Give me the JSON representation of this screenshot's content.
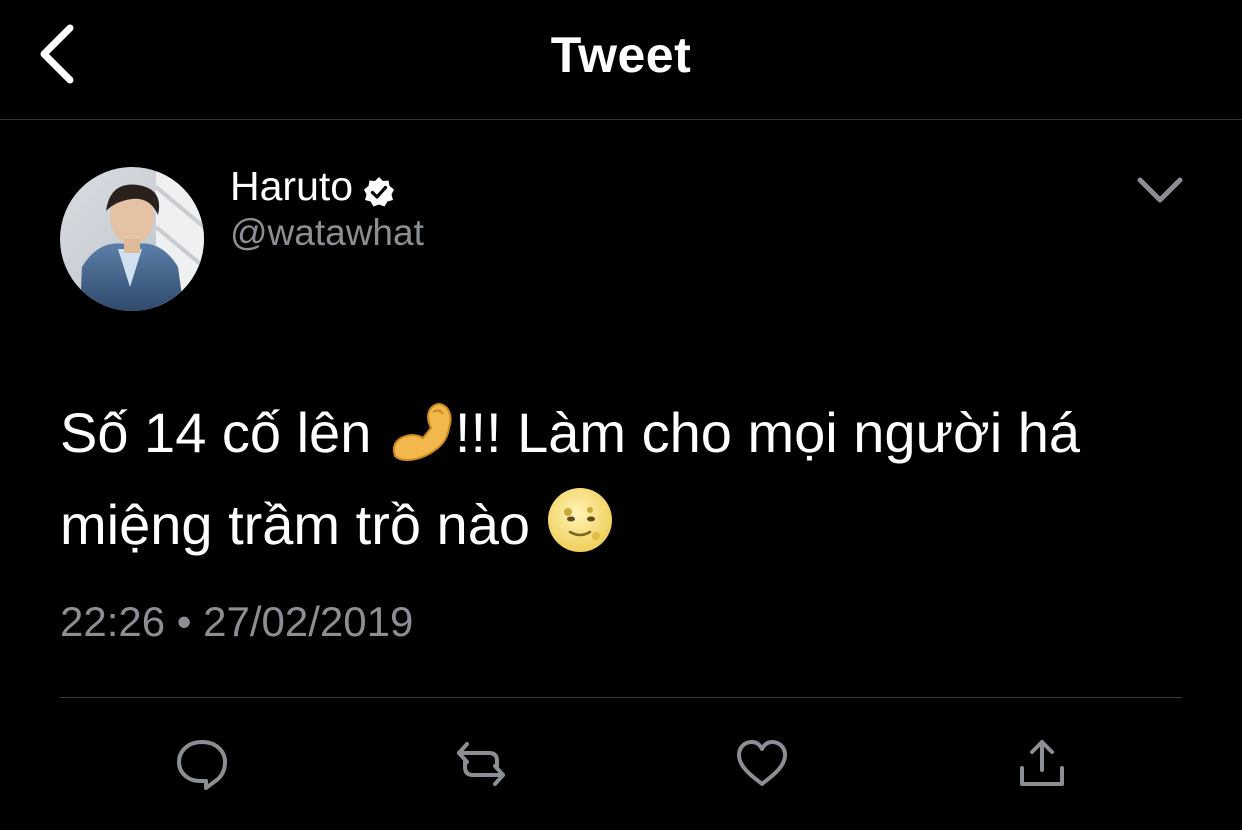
{
  "nav": {
    "title": "Tweet",
    "back_icon": "chevron-left-icon"
  },
  "tweet": {
    "author": {
      "display_name": "Haruto",
      "handle": "@watawhat",
      "verified_icon": "verified-badge-icon"
    },
    "text_line1_part1": "Số 14 cố lên ",
    "emoji1": "flexed-biceps-emoji",
    "text_line1_part2": "!!! Làm cho mọi người há",
    "text_line2": "miệng trầm trồ nào ",
    "emoji2": "full-moon-face-emoji",
    "timestamp": "22:26 • 27/02/2019"
  },
  "actions": [
    {
      "name": "reply",
      "icon": "reply-icon"
    },
    {
      "name": "retweet",
      "icon": "retweet-icon"
    },
    {
      "name": "like",
      "icon": "heart-icon"
    },
    {
      "name": "share",
      "icon": "share-icon"
    }
  ],
  "colors": {
    "background": "#000000",
    "text_primary": "#ffffff",
    "text_secondary": "#8b8f94",
    "icon": "#8b8f94",
    "divider": "#3a3d41"
  }
}
